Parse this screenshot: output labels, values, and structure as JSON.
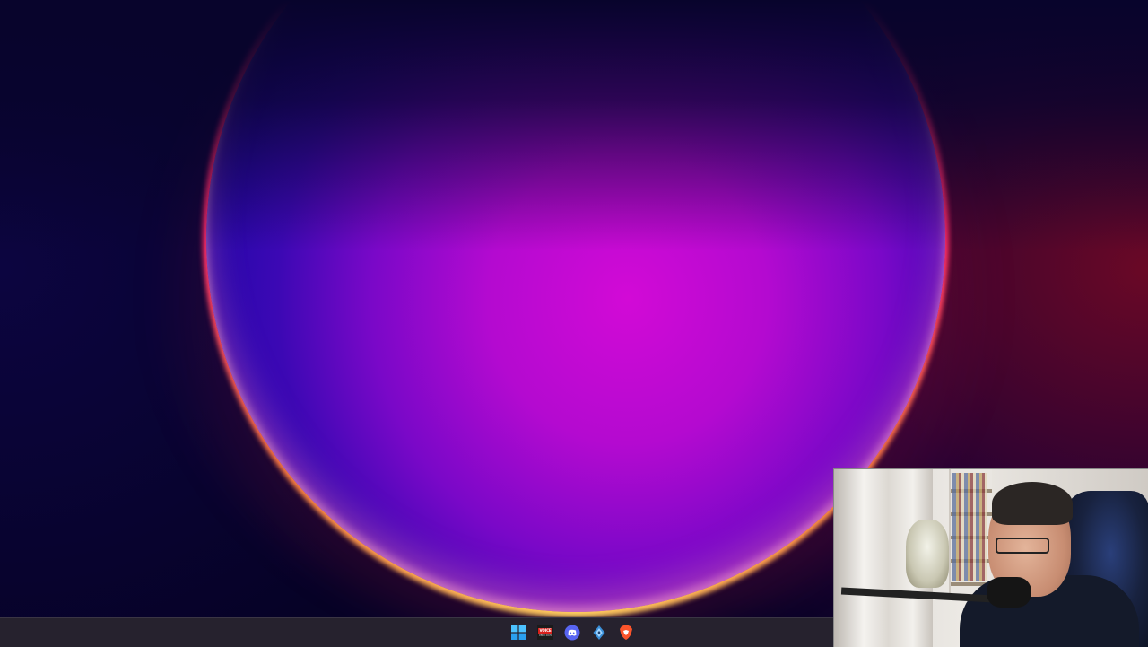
{
  "desktop": {
    "wallpaper": "purple-orb-wallpaper"
  },
  "taskbar": {
    "pinned": [
      {
        "name": "start-button",
        "icon": "windows-start-icon"
      },
      {
        "name": "voicemeeter-button",
        "icon": "voicemeeter-icon",
        "label_top": "VOICE",
        "label_bottom": "MEETER"
      },
      {
        "name": "discord-button",
        "icon": "discord-icon"
      },
      {
        "name": "app-button",
        "icon": "diamond-app-icon"
      },
      {
        "name": "brave-browser-button",
        "icon": "brave-lion-icon"
      }
    ]
  },
  "webcam_overlay": {
    "description": "webcam-feed"
  },
  "colors": {
    "taskbar_bg": "#26222e",
    "accent_windows": "#4cc2ff",
    "discord": "#5865f2",
    "brave": "#fb542b"
  }
}
